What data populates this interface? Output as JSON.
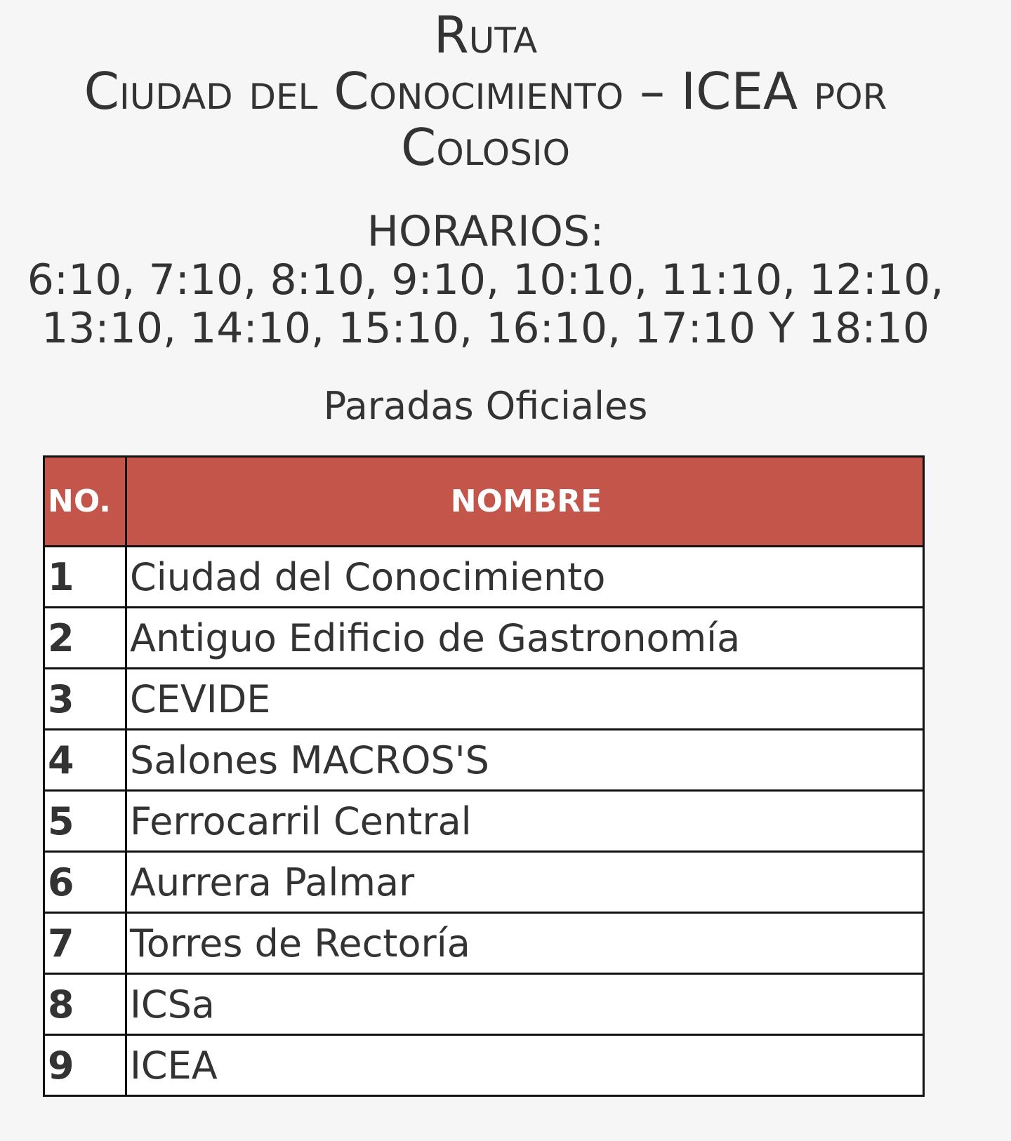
{
  "route": {
    "title_line1": "Ruta",
    "title_line2": "Ciudad del Conocimiento – ICEA por",
    "title_line3": "Colosio"
  },
  "schedule": {
    "label": "HORARIOS:",
    "times_line1": "6:10, 7:10, 8:10, 9:10, 10:10, 11:10, 12:10,",
    "times_line2": "13:10, 14:10, 15:10, 16:10, 17:10 Y 18:10"
  },
  "stops": {
    "heading": "Paradas Oficiales",
    "columns": {
      "no": "NO.",
      "name": "NOMBRE"
    },
    "header_color": "#c4554b",
    "rows": [
      {
        "no": "1",
        "name": "Ciudad del Conocimiento"
      },
      {
        "no": "2",
        "name": "Antiguo Edificio de Gastronomía"
      },
      {
        "no": "3",
        "name": "CEVIDE"
      },
      {
        "no": "4",
        "name": "Salones MACROS'S"
      },
      {
        "no": "5",
        "name": "Ferrocarril Central"
      },
      {
        "no": "6",
        "name": "Aurrera Palmar"
      },
      {
        "no": "7",
        "name": "Torres de Rectoría"
      },
      {
        "no": "8",
        "name": "ICSa"
      },
      {
        "no": "9",
        "name": "ICEA"
      }
    ]
  }
}
